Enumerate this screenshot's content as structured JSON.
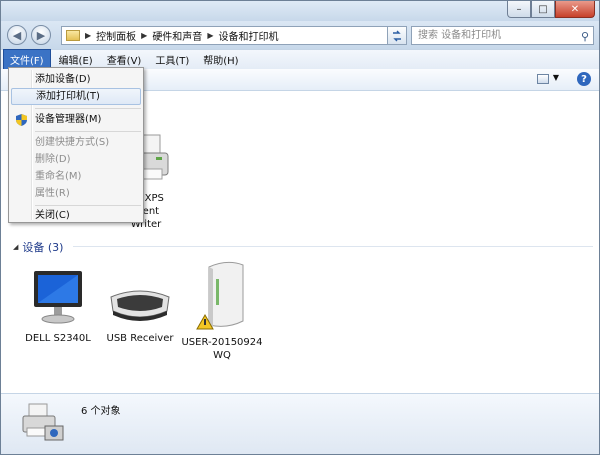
{
  "window": {
    "buttons": {
      "minimize": "–",
      "maximize": "□",
      "close": "✕"
    }
  },
  "nav": {
    "back": "◀",
    "forward": "▶",
    "breadcrumb": [
      "控制面板",
      "硬件和声音",
      "设备和打印机"
    ],
    "search_placeholder": "搜索 设备和打印机"
  },
  "menubar": {
    "items": [
      "文件(F)",
      "编辑(E)",
      "查看(V)",
      "工具(T)",
      "帮助(H)"
    ]
  },
  "file_menu": {
    "items": [
      {
        "label": "添加设备(D)",
        "state": "normal"
      },
      {
        "label": "添加打印机(T)",
        "state": "hover"
      },
      {
        "label": "设备管理器(M)",
        "state": "normal",
        "icon": "shield-icon"
      },
      {
        "label": "创建快捷方式(S)",
        "state": "disabled"
      },
      {
        "label": "删除(D)",
        "state": "disabled"
      },
      {
        "label": "重命名(M)",
        "state": "disabled"
      },
      {
        "label": "属性(R)",
        "state": "disabled"
      },
      {
        "label": "关闭(C)",
        "state": "normal"
      }
    ]
  },
  "printers_group": {
    "items": [
      {
        "caption": "oft XPS\nment\nWriter",
        "icon": "printer-icon"
      }
    ]
  },
  "devices_group": {
    "title": "设备 (3)",
    "items": [
      {
        "caption": "DELL S2340L",
        "icon": "monitor-icon"
      },
      {
        "caption": "USB Receiver",
        "icon": "keyboard-icon"
      },
      {
        "caption": "USER-20150924\nWQ",
        "icon": "computer-tower-icon",
        "warning": true
      }
    ]
  },
  "statusbar": {
    "count": "6 个对象"
  },
  "colors": {
    "accent": "#3b73c5",
    "group_header": "#1e3a8a"
  }
}
